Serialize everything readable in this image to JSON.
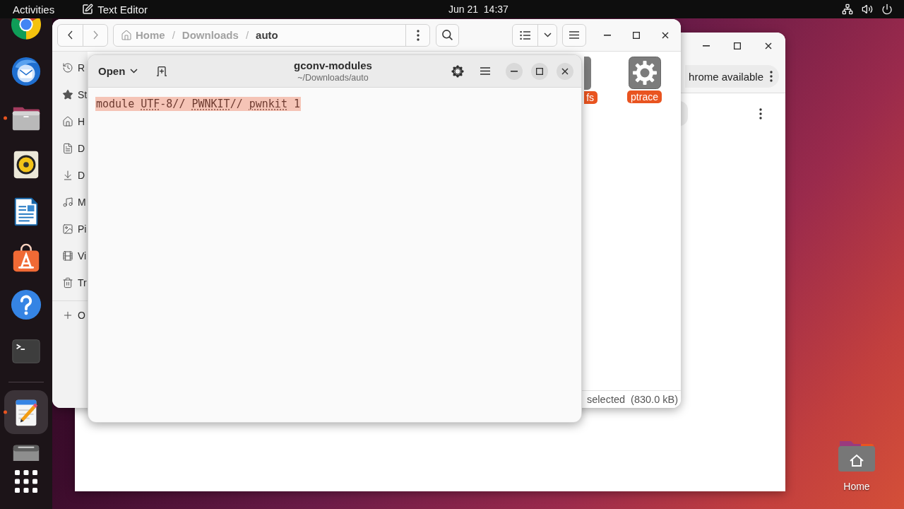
{
  "top_bar": {
    "activities": "Activities",
    "app_name": "Text Editor",
    "clock": "Jun 21  14:37"
  },
  "dock": {
    "favorites": [
      {
        "kind": "browser",
        "running": false,
        "selected": false
      },
      {
        "kind": "mail",
        "running": false,
        "selected": false
      },
      {
        "kind": "files",
        "running": true,
        "selected": false
      },
      {
        "kind": "music",
        "running": false,
        "selected": false
      },
      {
        "kind": "writer",
        "running": false,
        "selected": false
      },
      {
        "kind": "store",
        "running": false,
        "selected": false
      },
      {
        "kind": "help",
        "running": false,
        "selected": false
      },
      {
        "kind": "terminal",
        "running": false,
        "selected": false
      }
    ],
    "others": [
      {
        "kind": "editor",
        "running": true,
        "selected": true
      },
      {
        "kind": "drive",
        "running": false,
        "selected": false
      }
    ]
  },
  "file_manager": {
    "path": [
      {
        "kind": "home",
        "label": "Home",
        "current": false
      },
      {
        "kind": "folder",
        "label": "Downloads",
        "current": false
      },
      {
        "kind": "folder",
        "label": "auto",
        "current": true
      }
    ],
    "path_separator": "/",
    "sidebar": {
      "places": [
        {
          "kind": "recent",
          "label": "R"
        },
        {
          "kind": "starred",
          "label": "St"
        },
        {
          "kind": "home",
          "label": "H"
        },
        {
          "kind": "documents",
          "label": "D"
        },
        {
          "kind": "downloads",
          "label": "D"
        },
        {
          "kind": "music",
          "label": "M"
        },
        {
          "kind": "pictures",
          "label": "Pi"
        },
        {
          "kind": "videos",
          "label": "Vi"
        },
        {
          "kind": "trash",
          "label": "Tr"
        }
      ],
      "other": {
        "label": "O"
      }
    },
    "files": [
      {
        "kind": "file",
        "name": "fs",
        "selected": true
      },
      {
        "kind": "settings",
        "name": "ptrace",
        "selected": true
      }
    ],
    "status": "selected  (830.0 kB)"
  },
  "text_editor": {
    "open_label": "Open",
    "title": "gconv-modules",
    "subtitle": "~/Downloads/auto",
    "lines": [
      {
        "selected": true,
        "segments": [
          {
            "text": "module ",
            "misspelled": false
          },
          {
            "text": "UTF",
            "misspelled": true
          },
          {
            "text": "-8// ",
            "misspelled": false
          },
          {
            "text": "PWNKIT",
            "misspelled": true
          },
          {
            "text": "// ",
            "misspelled": false
          },
          {
            "text": "pwnkit",
            "misspelled": true
          },
          {
            "text": " 1",
            "misspelled": false
          }
        ]
      }
    ]
  },
  "browser_window": {
    "notice": "hrome available"
  },
  "desktop_icons": [
    {
      "kind": "home",
      "label": "Home"
    }
  ]
}
